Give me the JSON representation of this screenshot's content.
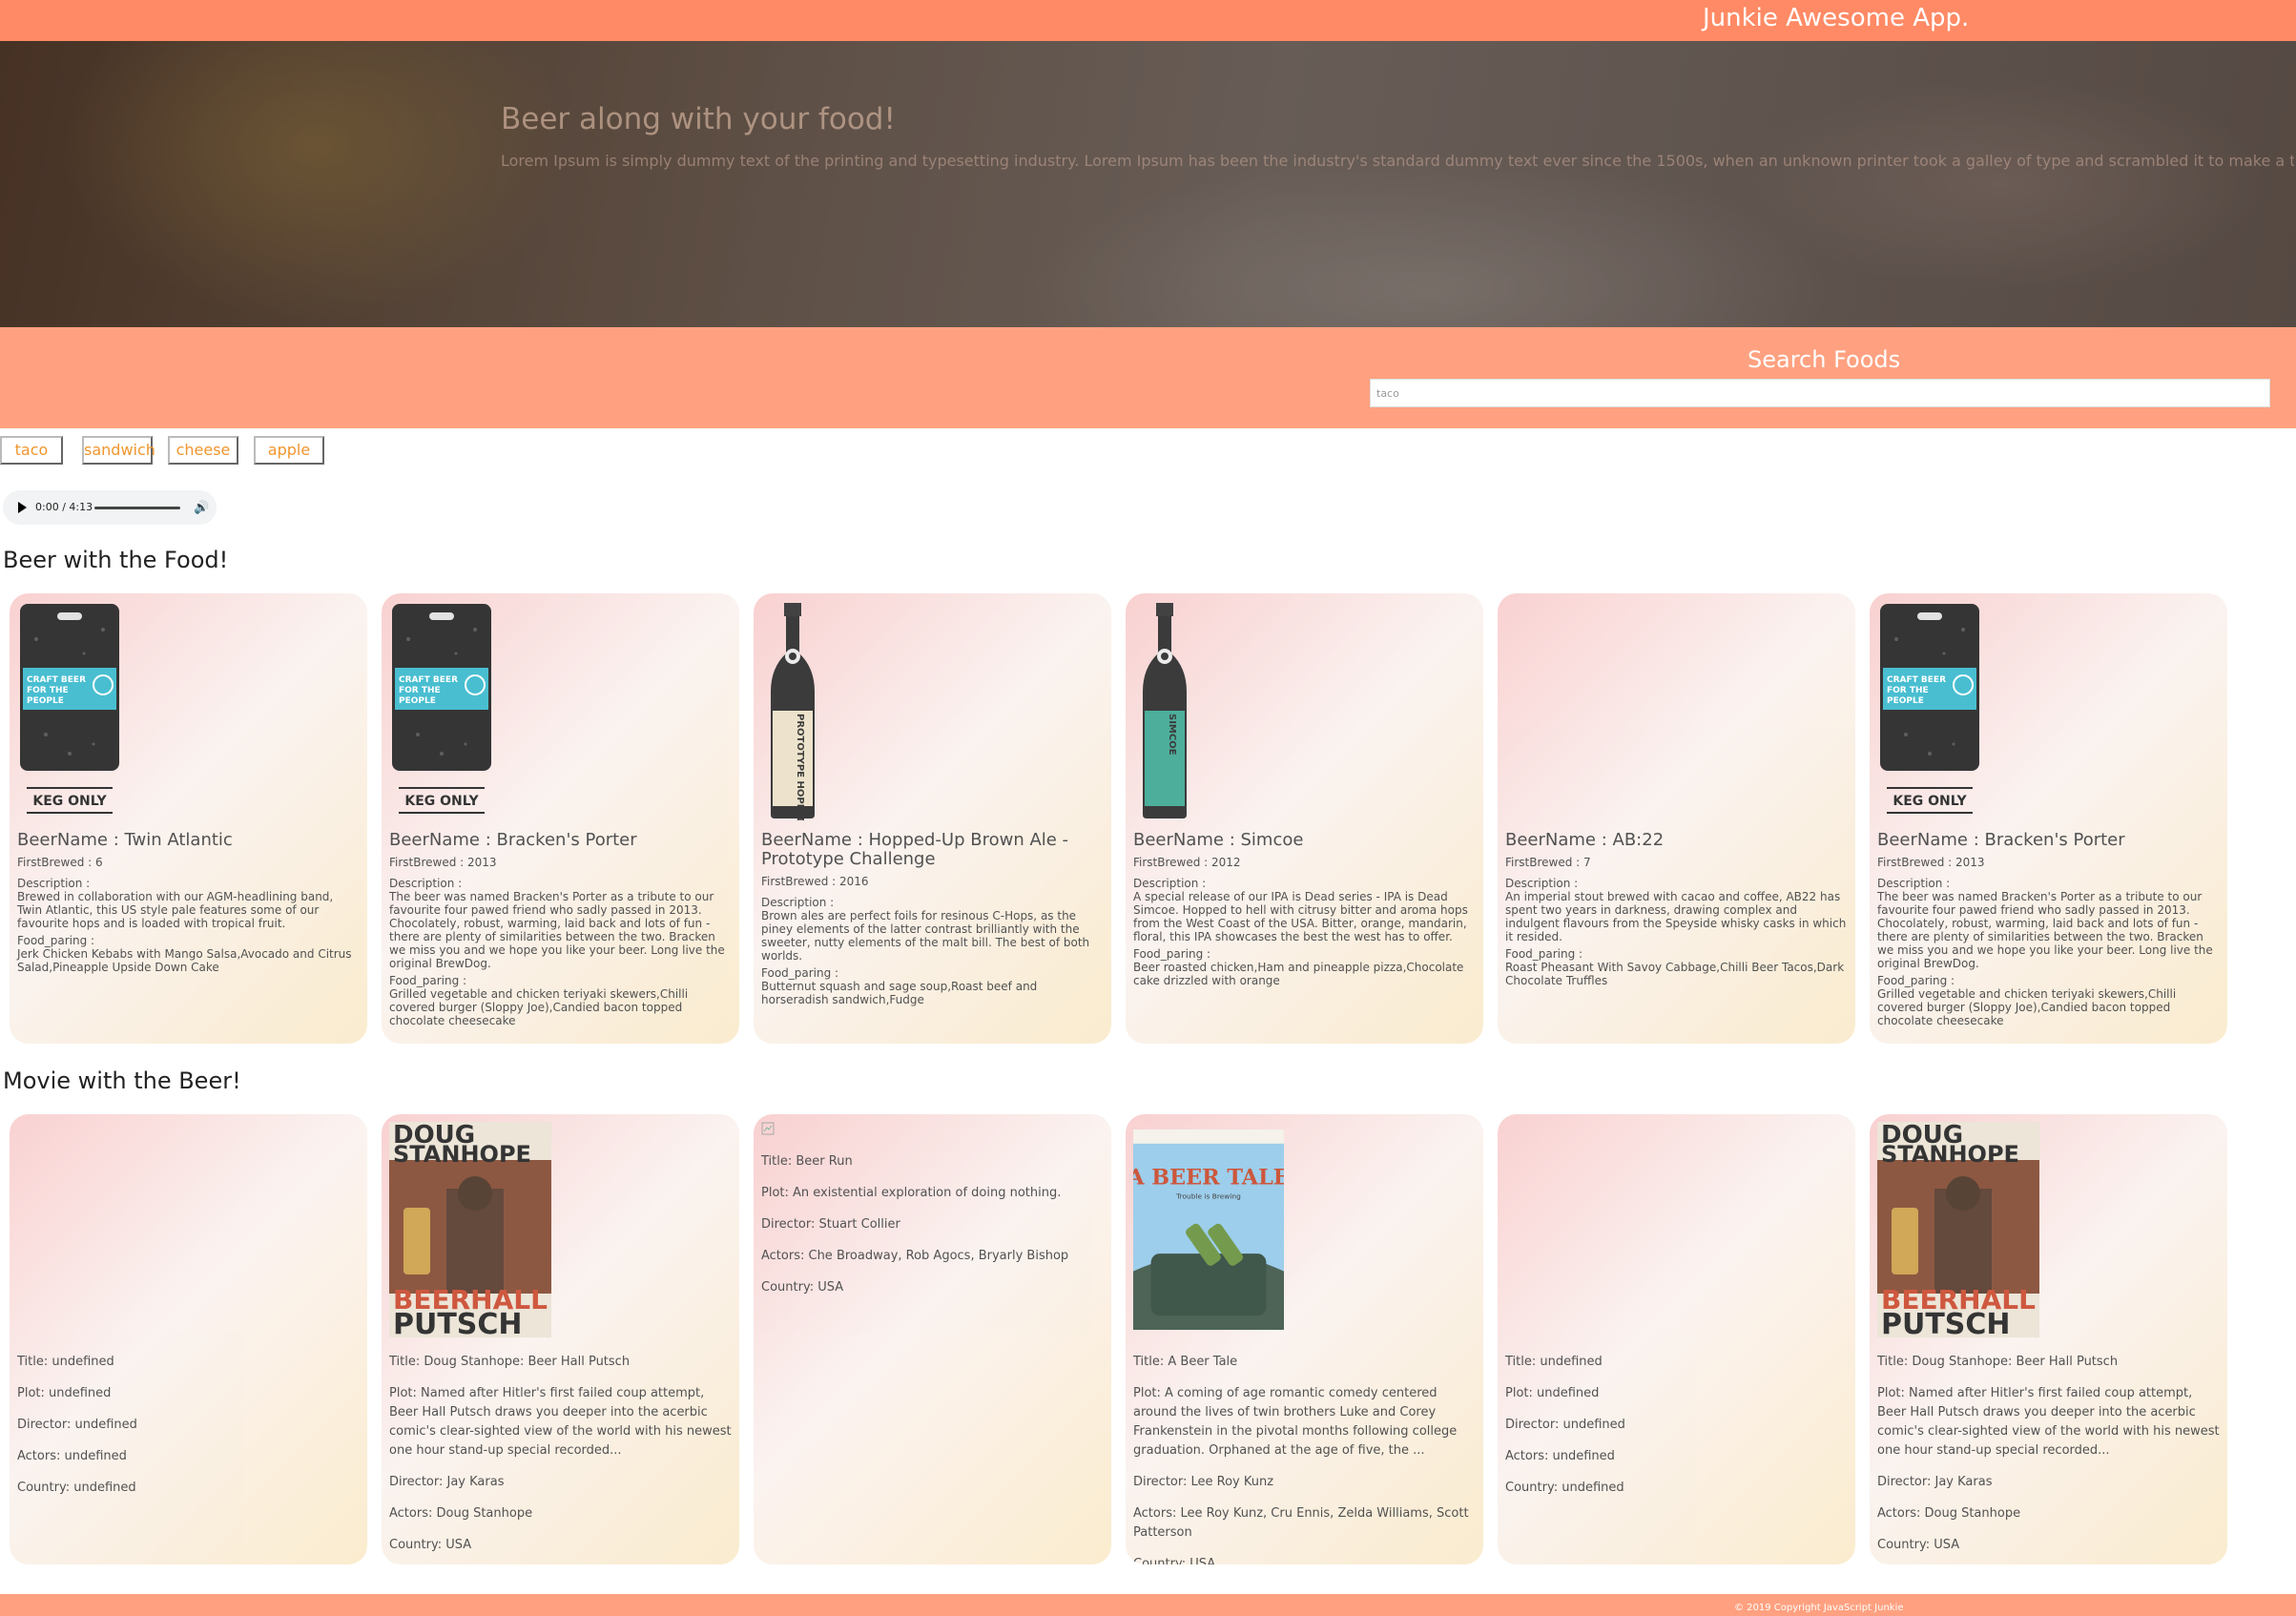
{
  "app_title": "Junkie Awesome App.",
  "hero": {
    "heading": "Beer along with your food!",
    "text": "Lorem Ipsum is simply dummy text of the printing and typesetting industry. Lorem Ipsum has been the industry's standard dummy text ever since the 1500s, when an unknown printer took a galley of type and scrambled it to make a type specimen book."
  },
  "search": {
    "title": "Search Foods",
    "value": "taco"
  },
  "chips": [
    "taco",
    "sandwich",
    "cheese",
    "apple"
  ],
  "audio": {
    "time": "0:00 / 4:13",
    "progress": 0
  },
  "beer_section_title": "Beer with the Food!",
  "movie_section_title": "Movie with the Beer!",
  "beers": [
    {
      "name": "BeerName : Twin Atlantic",
      "first_brewed": "FirstBrewed : 6",
      "description_label": "Description :",
      "description": "Brewed in collaboration with our AGM-headlining band, Twin Atlantic, this US style pale features some of our favourite hops and is loaded with tropical fruit.",
      "food_label": "Food_paring :",
      "food": "Jerk Chicken Kebabs with Mango Salsa,Avocado and Citrus Salad,Pineapple Upside Down Cake",
      "image": "keg",
      "keg_label": "KEG ONLY",
      "keg_text": "CRAFT BEER FOR THE PEOPLE"
    },
    {
      "name": "BeerName : Bracken's Porter",
      "first_brewed": "FirstBrewed : 2013",
      "description_label": "Description :",
      "description": "The beer was named Bracken's Porter as a tribute to our favourite four pawed friend who sadly passed in 2013. Chocolately, robust, warming, laid back and lots of fun - there are plenty of similarities between the two. Bracken we miss you and we hope you like your beer. Long live the original BrewDog.",
      "food_label": "Food_paring :",
      "food": "Grilled vegetable and chicken teriyaki skewers,Chilli covered burger (Sloppy Joe),Candied bacon topped chocolate cheesecake",
      "image": "keg",
      "keg_label": "KEG ONLY",
      "keg_text": "CRAFT BEER FOR THE PEOPLE"
    },
    {
      "name": "BeerName : Hopped-Up Brown Ale - Prototype Challenge",
      "first_brewed": "FirstBrewed : 2016",
      "description_label": "Description :",
      "description": "Brown ales are perfect foils for resinous C-Hops, as the piney elements of the latter contrast brilliantly with the sweeter, nutty elements of the malt bill. The best of both worlds.",
      "food_label": "Food_paring :",
      "food": "Butternut squash and sage soup,Roast beef and horseradish sandwich,Fudge",
      "image": "bottle-brown",
      "bottle_label": "PROTOTYPE HOPPED-UP BROWN ALE"
    },
    {
      "name": "BeerName : Simcoe",
      "first_brewed": "FirstBrewed : 2012",
      "description_label": "Description :",
      "description": "A special release of our IPA is Dead series - IPA is Dead Simcoe. Hopped to hell with citrusy bitter and aroma hops from the West Coast of the USA. Bitter, orange, mandarin, floral, this IPA showcases the best the west has to offer.",
      "food_label": "Food_paring :",
      "food": "Beer roasted chicken,Ham and pineapple pizza,Chocolate cake drizzled with orange",
      "image": "bottle-teal",
      "bottle_label": "SIMCOE"
    },
    {
      "name": "BeerName : AB:22",
      "first_brewed": "FirstBrewed : 7",
      "description_label": "Description :",
      "description": "An imperial stout brewed with cacao and coffee, AB22 has spent two years in darkness, drawing complex and indulgent flavours from the Speyside whisky casks in which it resided.",
      "food_label": "Food_paring :",
      "food": "Roast Pheasant With Savoy Cabbage,Chilli Beer Tacos,Dark Chocolate Truffles",
      "image": "none"
    },
    {
      "name": "BeerName : Bracken's Porter",
      "first_brewed": "FirstBrewed : 2013",
      "description_label": "Description :",
      "description": "The beer was named Bracken's Porter as a tribute to our favourite four pawed friend who sadly passed in 2013. Chocolately, robust, warming, laid back and lots of fun - there are plenty of similarities between the two. Bracken we miss you and we hope you like your beer. Long live the original BrewDog.",
      "food_label": "Food_paring :",
      "food": "Grilled vegetable and chicken teriyaki skewers,Chilli covered burger (Sloppy Joe),Candied bacon topped chocolate cheesecake",
      "image": "keg",
      "keg_label": "KEG ONLY",
      "keg_text": "CRAFT BEER FOR THE PEOPLE"
    }
  ],
  "movies": [
    {
      "poster": "none",
      "title": "Title: undefined",
      "plot": "Plot: undefined",
      "director": "Director: undefined",
      "actors": "Actors: undefined",
      "country": "Country: undefined"
    },
    {
      "poster": "stanhope",
      "poster_top": "DOUG STANHOPE",
      "poster_bottom": "BEER HALL PUTSCH",
      "title": "Title: Doug Stanhope: Beer Hall Putsch",
      "plot": "Plot: Named after Hitler's first failed coup attempt, Beer Hall Putsch draws you deeper into the acerbic comic's clear-sighted view of the world with his newest one hour stand-up special recorded...",
      "director": "Director: Jay Karas",
      "actors": "Actors: Doug Stanhope",
      "country": "Country: USA"
    },
    {
      "poster": "broken",
      "title": "Title: Beer Run",
      "plot": "Plot: An existential exploration of doing nothing.",
      "director": "Director: Stuart Collier",
      "actors": "Actors: Che Broadway, Rob Agocs, Bryarly Bishop",
      "country": "Country: USA"
    },
    {
      "poster": "beertale",
      "poster_title": "A BEER TALE",
      "poster_tagline": "Trouble is Brewing",
      "title": "Title: A Beer Tale",
      "plot": "Plot: A coming of age romantic comedy centered around the lives of twin brothers Luke and Corey Frankenstein in the pivotal months following college graduation. Orphaned at the age of five, the ...",
      "director": "Director: Lee Roy Kunz",
      "actors": "Actors: Lee Roy Kunz, Cru Ennis, Zelda Williams, Scott Patterson",
      "country": "Country: USA"
    },
    {
      "poster": "none",
      "title": "Title: undefined",
      "plot": "Plot: undefined",
      "director": "Director: undefined",
      "actors": "Actors: undefined",
      "country": "Country: undefined"
    },
    {
      "poster": "stanhope",
      "poster_top": "DOUG STANHOPE",
      "poster_bottom": "BEER HALL PUTSCH",
      "title": "Title: Doug Stanhope: Beer Hall Putsch",
      "plot": "Plot: Named after Hitler's first failed coup attempt, Beer Hall Putsch draws you deeper into the acerbic comic's clear-sighted view of the world with his newest one hour stand-up special recorded...",
      "director": "Director: Jay Karas",
      "actors": "Actors: Doug Stanhope",
      "country": "Country: USA"
    }
  ],
  "footer": "© 2019 Copyright JavaScript Junkie",
  "colors": {
    "header": "#ff8a65",
    "search_band": "#ffa180",
    "chip_text": "#f0962e"
  }
}
